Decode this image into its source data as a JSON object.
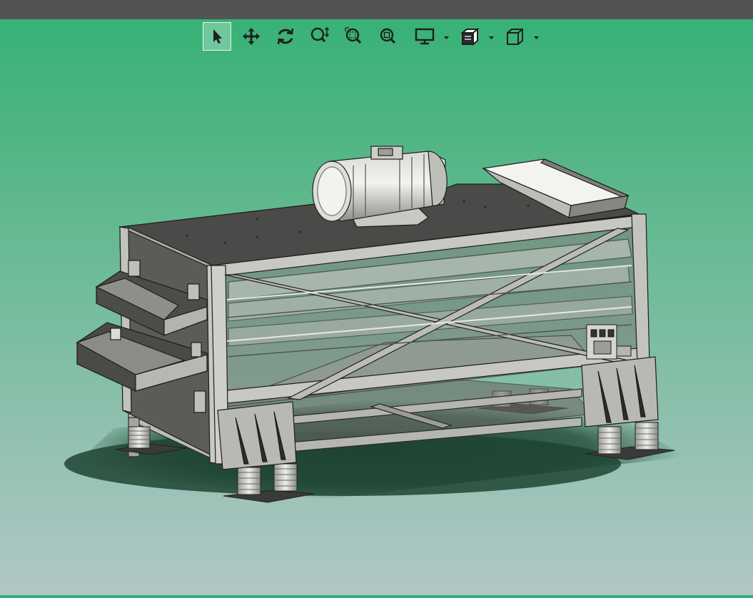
{
  "window": {
    "titlebar_color": "#535353"
  },
  "viewport": {
    "background_top": "#33b174",
    "background_bottom": "#b2c7c6"
  },
  "toolbar": {
    "items": [
      {
        "icon": "select-arrow-icon",
        "active": true
      },
      {
        "icon": "pan-icon",
        "active": false
      },
      {
        "icon": "rotate-icon",
        "active": false
      },
      {
        "icon": "zoom-in-out-icon",
        "active": false
      },
      {
        "icon": "zoom-to-area-icon",
        "active": false
      },
      {
        "icon": "zoom-to-fit-icon",
        "active": false
      },
      {
        "icon": "display-mode-icon",
        "active": false,
        "has_dropdown": true
      },
      {
        "icon": "section-view-icon",
        "active": false,
        "has_dropdown": true
      },
      {
        "icon": "standard-views-cube-icon",
        "active": false,
        "has_dropdown": true
      }
    ]
  },
  "model": {
    "description_icon": "vibrating-screen-model"
  }
}
